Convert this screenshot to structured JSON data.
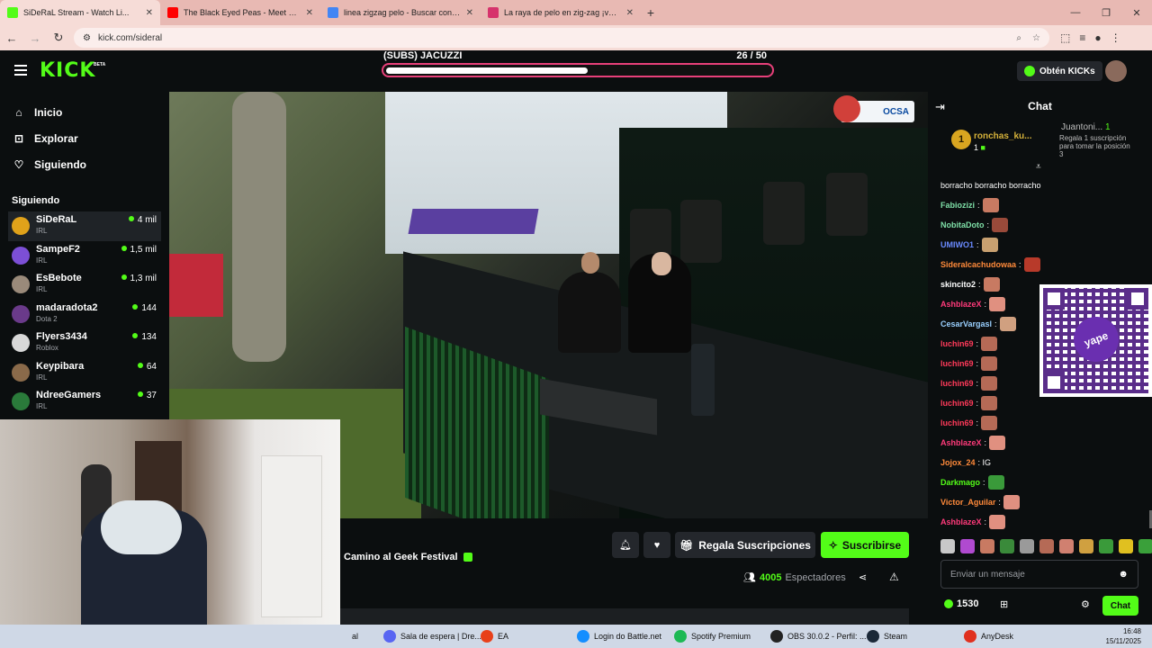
{
  "browser": {
    "tabs": [
      {
        "title": "SiDeRaL Stream - Watch Li...",
        "favicon_color": "#53fc18",
        "active": true
      },
      {
        "title": "The Black Eyed Peas - Meet Me...",
        "favicon_color": "#ff0000"
      },
      {
        "title": "linea zigzag pelo - Buscar con G...",
        "favicon_color": "#4285f4"
      },
      {
        "title": "La raya de pelo en zig-zag ¡vue...",
        "favicon_color": "#d6336c"
      }
    ],
    "url": "kick.com/sideral"
  },
  "header": {
    "logo": "KICK",
    "beta": "BETA",
    "goal_title": "(SUBS) JACUZZI",
    "goal_count": "26 / 50",
    "goal_progress": 0.52,
    "kicks_button": "Obtén KICKs"
  },
  "sidebar": {
    "nav": [
      {
        "label": "Inicio",
        "icon": "home-icon"
      },
      {
        "label": "Explorar",
        "icon": "compass-icon"
      },
      {
        "label": "Siguiendo",
        "icon": "heart-icon"
      }
    ],
    "following_title": "Siguiendo",
    "channels": [
      {
        "name": "SiDeRaL",
        "category": "IRL",
        "viewers": "4 mil",
        "avatar_color": "#e0a21a",
        "active": true
      },
      {
        "name": "SampeF2",
        "category": "IRL",
        "viewers": "1,5 mil",
        "avatar_color": "#7c4fd6"
      },
      {
        "name": "EsBebote",
        "category": "IRL",
        "viewers": "1,3 mil",
        "avatar_color": "#9a8a7a"
      },
      {
        "name": "madaradota2",
        "category": "Dota 2",
        "viewers": "144",
        "avatar_color": "#6a3a8a"
      },
      {
        "name": "Flyers3434",
        "category": "Roblox",
        "viewers": "134",
        "avatar_color": "#d8d8d8"
      },
      {
        "name": "Keypibara",
        "category": "IRL",
        "viewers": "64",
        "avatar_color": "#8a6a4a"
      },
      {
        "name": "NdreeGamers",
        "category": "IRL",
        "viewers": "37",
        "avatar_color": "#2a7a3a"
      }
    ]
  },
  "video": {
    "sponsor": "OCSA"
  },
  "stream": {
    "title": "Camino al Geek Festival",
    "gift_label": "Regala Suscripciones",
    "subscribe_label": "Suscribirse",
    "viewers_count": "4005",
    "viewers_label": "Espectadores"
  },
  "chat": {
    "title": "Chat",
    "pinned": {
      "rank": "1",
      "user": "ronchas_ku...",
      "count": "1",
      "other_user": "Juantoni...",
      "other_count": "1",
      "other_text": "Regala 1 suscripción para tomar la posición 3"
    },
    "messages": [
      {
        "user": "",
        "text": "borracho borracho borracho",
        "color": "#ffffff",
        "emote": ""
      },
      {
        "user": "Fabiozizi",
        "text": ":",
        "color": "#7fe0a8",
        "emote": "#c87a62"
      },
      {
        "user": "NobitaDoto",
        "text": ":",
        "color": "#7fe0a8",
        "emote": "#9a4a3a"
      },
      {
        "user": "UMIWO1",
        "text": ":",
        "color": "#6a8aff",
        "emote": "#c8a070"
      },
      {
        "user": "Sideralcachudowaa",
        "text": ":",
        "color": "#ff8a3a",
        "emote": "#b83a2a"
      },
      {
        "user": "skincito2",
        "text": ":",
        "color": "#ffffff",
        "emote": "#c87a62"
      },
      {
        "user": "AshblazeX",
        "text": ":",
        "color": "#ff3a7a",
        "emote": "#e09080"
      },
      {
        "user": "CesarVargasl",
        "text": ":",
        "color": "#9ad0ff",
        "emote": "#d0a080"
      },
      {
        "user": "luchin69",
        "text": ":",
        "color": "#ff3a5a",
        "emote": "#b56a56"
      },
      {
        "user": "luchin69",
        "text": ":",
        "color": "#ff3a5a",
        "emote": "#b56a56"
      },
      {
        "user": "luchin69",
        "text": ":",
        "color": "#ff3a5a",
        "emote": "#b56a56"
      },
      {
        "user": "luchin69",
        "text": ":",
        "color": "#ff3a5a",
        "emote": "#b56a56"
      },
      {
        "user": "luchin69",
        "text": ":",
        "color": "#ff3a5a",
        "emote": "#b56a56"
      },
      {
        "user": "AshblazeX",
        "text": ":",
        "color": "#ff3a7a",
        "emote": "#e09080"
      },
      {
        "user": "Jojox_24",
        "text": ": IG",
        "color": "#ff8a3a",
        "emote": ""
      },
      {
        "user": "Darkmago",
        "text": ":",
        "color": "#53fc18",
        "emote": "#3a9a3a"
      },
      {
        "user": "Victor_Aguilar",
        "text": ":",
        "color": "#ff8a3a",
        "emote": "#e09080"
      },
      {
        "user": "AshblazeX",
        "text": ":",
        "color": "#ff3a7a",
        "emote": "#e09080"
      }
    ],
    "qr_brand": "yape",
    "emote_bar": [
      "#c8c8c8",
      "#b04ad0",
      "#c87a62",
      "#3a8a3a",
      "#9a9a9a",
      "#b56a56",
      "#d08070",
      "#d0a040",
      "#3a9a3a",
      "#e0c020",
      "#3aa03a"
    ],
    "input_placeholder": "Enviar un mensaje",
    "kicks_balance": "1530",
    "chat_button": "Chat"
  },
  "taskbar": {
    "items": [
      {
        "label": "al",
        "icon_color": "#cfd8e6"
      },
      {
        "label": "Sala de espera | Dre...",
        "icon_color": "#5865f2"
      },
      {
        "label": "EA",
        "icon_color": "#e8401a"
      },
      {
        "label": "Login do Battle.net",
        "icon_color": "#148eff"
      },
      {
        "label": "Spotify Premium",
        "icon_color": "#1db954"
      },
      {
        "label": "OBS 30.0.2 - Perfil: ...",
        "icon_color": "#222222"
      },
      {
        "label": "Steam",
        "icon_color": "#1b2838"
      },
      {
        "label": "AnyDesk",
        "icon_color": "#e0301e"
      }
    ],
    "time": "16:48",
    "date": "15/11/2025"
  }
}
